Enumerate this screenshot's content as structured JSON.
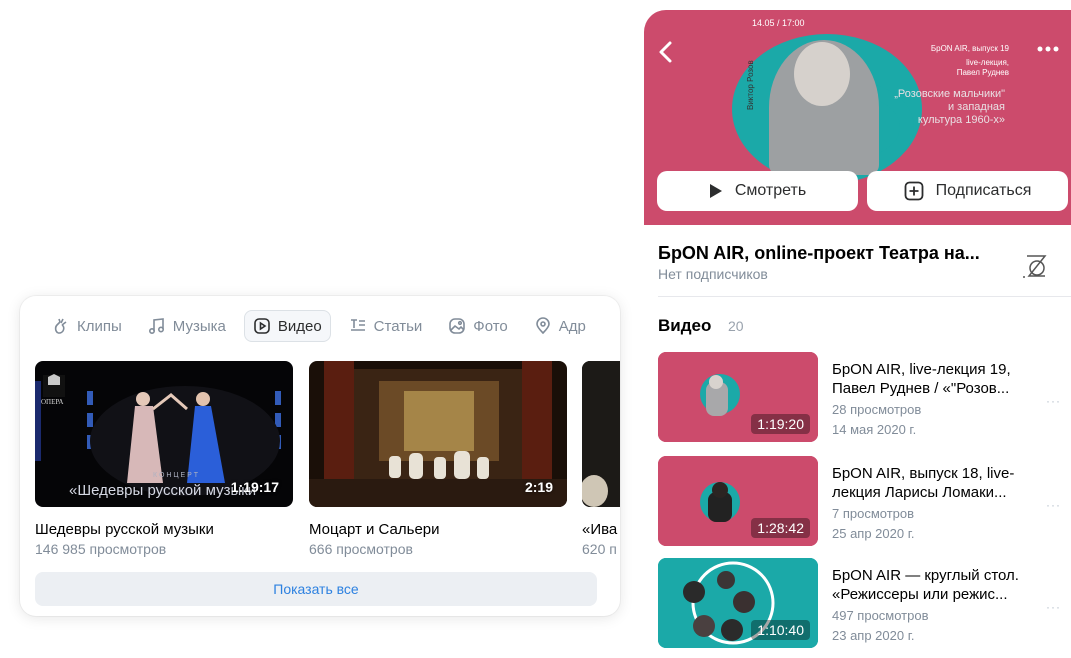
{
  "tabs": [
    {
      "label": "Клипы",
      "icon": "clips-icon"
    },
    {
      "label": "Музыка",
      "icon": "music-note-icon"
    },
    {
      "label": "Видео",
      "icon": "video-play-icon",
      "active": true
    },
    {
      "label": "Статьи",
      "icon": "articles-icon"
    },
    {
      "label": "Фото",
      "icon": "photo-icon"
    },
    {
      "label": "Адр",
      "icon": "location-pin-icon"
    }
  ],
  "videos": [
    {
      "title": "Шедевры русской музыки",
      "views": "146 985 просмотров",
      "duration": "1:19:17",
      "overlay": "«Шедевры русской музыки",
      "overlay_small": "К О Н Ц Е Р Т",
      "badge": "ОПЕРА"
    },
    {
      "title": "Моцарт и Сальери",
      "views": "666 просмотров",
      "duration": "2:19"
    },
    {
      "title": "«Ива",
      "views": "620 п"
    }
  ],
  "show_all_label": "Показать все",
  "cover": {
    "date": "14.05 / 17:00",
    "issue": "БрON AIR, выпуск 19",
    "lecture_line1": "live-лекция,",
    "lecture_line2": "Павел Руднев",
    "theme_line1": "„Розовские мальчики\"",
    "theme_line2": "и западная",
    "theme_line3": "культура 1960-х»",
    "author_vertical": "Виктор Розов"
  },
  "actions": {
    "watch": "Смотреть",
    "subscribe": "Подписаться"
  },
  "group": {
    "title": "БрON AIR, online-проект Театра на...",
    "subscribers": "Нет подписчиков"
  },
  "section": {
    "title": "Видео",
    "count": "20"
  },
  "list": [
    {
      "title": "БрON AIR, live-лекция 19, Павел Руднев / «\"Розов...",
      "views": "28 просмотров",
      "date": "14 мая 2020 г.",
      "duration": "1:19:20"
    },
    {
      "title": "БрON AIR, выпуск 18, live-лекция Ларисы Ломаки...",
      "views": "7 просмотров",
      "date": "25 апр 2020 г.",
      "duration": "1:28:42"
    },
    {
      "title": "БрON AIR — круглый стол. «Режиссеры или режис...",
      "views": "497 просмотров",
      "date": "23 апр 2020 г.",
      "duration": "1:10:40"
    }
  ],
  "more_dots": "···",
  "colors": {
    "accent_blue": "#2d81e0",
    "cover_pink": "#cc4b6c",
    "teal": "#1ba9a8",
    "muted": "#818c99"
  }
}
